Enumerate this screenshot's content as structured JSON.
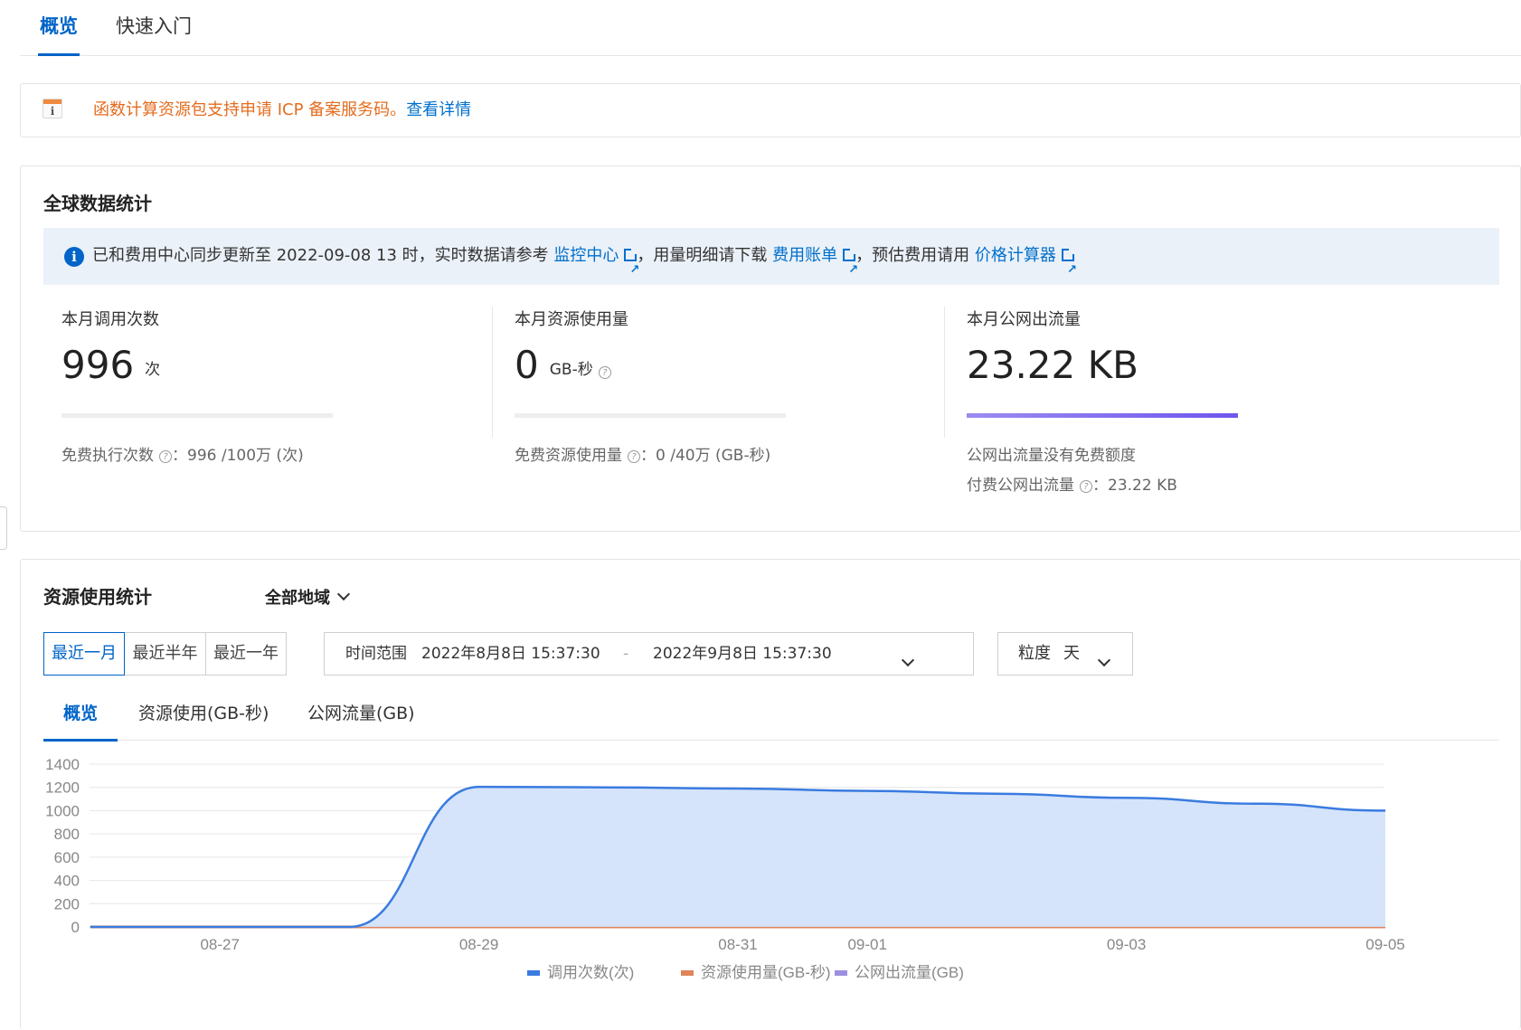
{
  "top_tabs": [
    {
      "label": "概览",
      "active": true
    },
    {
      "label": "快速入门",
      "active": false
    }
  ],
  "notice": {
    "icon": "notice-i-icon",
    "text": "函数计算资源包支持申请 ICP 备案服务码。",
    "link": "查看详情"
  },
  "global_stats": {
    "title": "全球数据统计",
    "info": {
      "prefix": "已和费用中心同步更新至 2022-09-08 13 时，实时数据请参考",
      "link1": "监控中心",
      "mid1": "，用量明细请下载",
      "link2": "费用账单",
      "mid2": "，预估费用请用",
      "link3": "价格计算器"
    },
    "invocations": {
      "title": "本月调用次数",
      "value": "996",
      "unit": "次",
      "usage_fraction": 0.001,
      "note_label": "免费执行次数",
      "note_value": "：996 /100万 (次)"
    },
    "resource": {
      "title": "本月资源使用量",
      "value": "0",
      "unit": "GB-秒",
      "usage_fraction": 0,
      "note_label": "免费资源使用量",
      "note_value": "：0 /40万 (GB-秒)"
    },
    "traffic": {
      "title": "本月公网出流量",
      "value": "23.22 KB",
      "usage_fraction": 1,
      "note1": "公网出流量没有免费额度",
      "note2_label": "付费公网出流量",
      "note2_value": "：23.22 KB"
    }
  },
  "usage_stats": {
    "title": "资源使用统计",
    "region": "全部地域",
    "ranges": [
      "最近一月",
      "最近半年",
      "最近一年"
    ],
    "active_range": "最近一月",
    "time_range_label": "时间范围",
    "start": "2022年8月8日 15:37:30",
    "separator": "-",
    "end": "2022年9月8日 15:37:30",
    "granularity_label": "粒度",
    "granularity_value": "天",
    "tabs": [
      "概览",
      "资源使用(GB-秒)",
      "公网流量(GB)"
    ],
    "active_tab": "概览"
  },
  "chart_data": {
    "type": "area",
    "x": [
      "08-26",
      "08-27",
      "08-28",
      "08-29",
      "08-30",
      "08-31",
      "09-01",
      "09-02",
      "09-03",
      "09-04",
      "09-05"
    ],
    "x_tick_labels": [
      "08-27",
      "08-29",
      "08-31",
      "09-01",
      "09-03",
      "09-05"
    ],
    "ylim": [
      0,
      1400
    ],
    "y_ticks": [
      0,
      200,
      400,
      600,
      800,
      1000,
      1200,
      1400
    ],
    "grid": true,
    "legend_position": "bottom",
    "series": [
      {
        "name": "调用次数(次)",
        "color": "#3a7be0",
        "fill": "#d3e3fa",
        "values": [
          0,
          0,
          0,
          1205,
          1200,
          1190,
          1170,
          1145,
          1110,
          1060,
          1000
        ]
      },
      {
        "name": "资源使用量(GB-秒)",
        "color": "#e0845a",
        "values": [
          0,
          0,
          0,
          0,
          0,
          0,
          0,
          0,
          0,
          0,
          0
        ]
      },
      {
        "name": "公网出流量(GB)",
        "color": "#9b8fe0",
        "values": [
          0,
          0,
          0,
          0,
          0,
          0,
          0,
          0,
          0,
          0,
          0
        ]
      }
    ]
  }
}
